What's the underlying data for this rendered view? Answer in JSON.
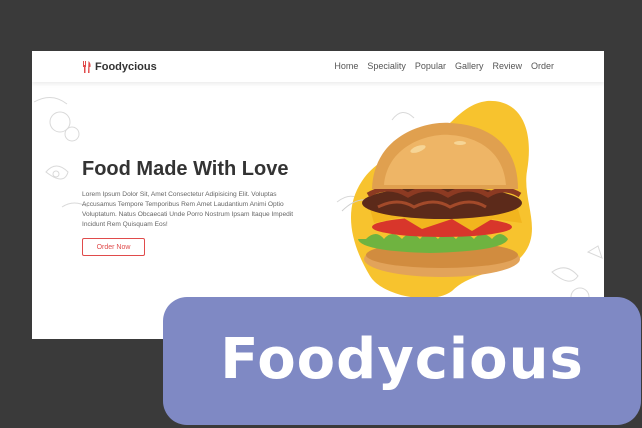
{
  "site": {
    "brand": "Foodycious",
    "nav": [
      "Home",
      "Speciality",
      "Popular",
      "Gallery",
      "Review",
      "Order"
    ]
  },
  "hero": {
    "title": "Food Made With Love",
    "description": "Lorem Ipsum Dolor Sit, Amet Consectetur Adipisicing Elit. Voluptas Accusamus Tempore Temporibus Rem Amet Laudantium Animi Optio Voluptatum. Natus Obcaecati Unde Porro Nostrum Ipsam Itaque Impedit Incidunt Rem Quisquam Eos!",
    "cta": "Order Now"
  },
  "banner": {
    "title": "Foodycious"
  },
  "icons": {
    "logo": "fork-knife-icon",
    "hero_image": "burger-icon"
  },
  "colors": {
    "accent": "#e04b4b",
    "blob": "#f7c32e",
    "banner": "#7f89c4",
    "backdrop": "#3a3a3a"
  }
}
